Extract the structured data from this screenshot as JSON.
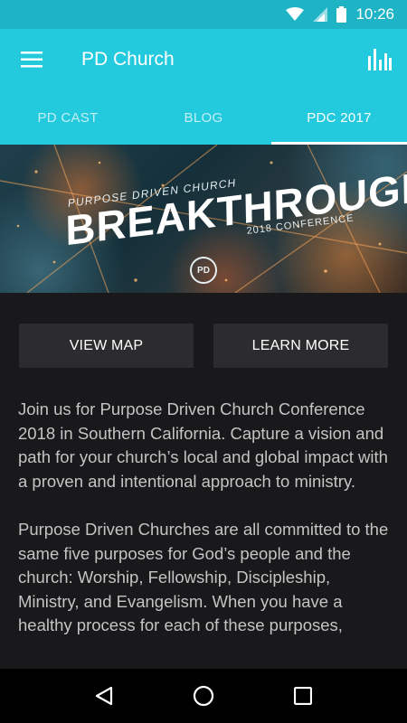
{
  "status_bar": {
    "time": "10:26",
    "icons": [
      "wifi-icon",
      "signal-icon",
      "battery-icon"
    ]
  },
  "app_bar": {
    "title": "PD Church",
    "menu_icon": "hamburger-menu-icon",
    "action_icon": "bar-chart-icon"
  },
  "tabs": [
    {
      "label": "PD CAST",
      "active": false
    },
    {
      "label": "BLOG",
      "active": false
    },
    {
      "label": "PDC 2017",
      "active": true
    }
  ],
  "banner": {
    "kicker": "PURPOSE DRIVEN CHURCH",
    "headline": "BREAKTHROUGH",
    "subtitle": "2018 CONFERENCE",
    "logo_text": "PD"
  },
  "buttons": {
    "view_map": "VIEW MAP",
    "learn_more": "LEARN MORE"
  },
  "content": {
    "paragraph_1": "Join us for Purpose Driven Church Conference 2018 in Southern California. Capture a vision and path for your church’s local and global impact with a proven and intentional approach to ministry.",
    "paragraph_2": "Purpose Driven Churches are all committed to the same five purposes for God’s people and the church: Worship, Fellowship, Discipleship, Ministry, and Evangelism. When you have a healthy process for each of these purposes,"
  },
  "nav_bar": {
    "icons": [
      "back-icon",
      "home-icon",
      "recents-icon"
    ]
  },
  "colors": {
    "status_bar": "#1fb3c6",
    "app_bar": "#23c9dd",
    "background": "#19191b",
    "button": "#2c2c2e"
  }
}
